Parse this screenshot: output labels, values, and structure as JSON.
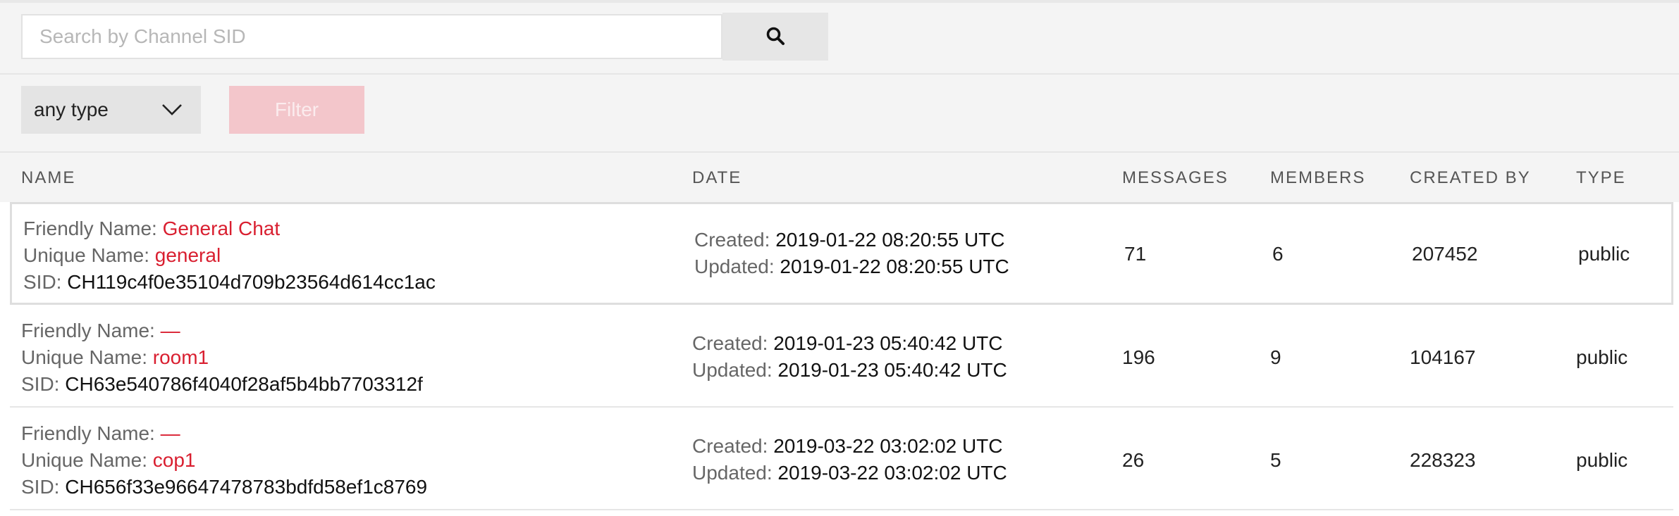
{
  "search": {
    "placeholder": "Search by Channel SID"
  },
  "filter": {
    "type_selected": "any type",
    "button_label": "Filter"
  },
  "columns": {
    "name": "NAME",
    "date": "DATE",
    "messages": "MESSAGES",
    "members": "MEMBERS",
    "created_by": "CREATED BY",
    "type": "TYPE"
  },
  "labels": {
    "friendly": "Friendly Name:",
    "unique": "Unique Name:",
    "sid": "SID:",
    "created": "Created:",
    "updated": "Updated:"
  },
  "rows": [
    {
      "friendly_name": "General Chat",
      "unique_name": "general",
      "sid": "CH119c4f0e35104d709b23564d614cc1ac",
      "created": "2019-01-22 08:20:55 UTC",
      "updated": "2019-01-22 08:20:55 UTC",
      "messages": "71",
      "members": "6",
      "created_by": "207452",
      "type": "public"
    },
    {
      "friendly_name": "—",
      "unique_name": "room1",
      "sid": "CH63e540786f4040f28af5b4bb7703312f",
      "created": "2019-01-23 05:40:42 UTC",
      "updated": "2019-01-23 05:40:42 UTC",
      "messages": "196",
      "members": "9",
      "created_by": "104167",
      "type": "public"
    },
    {
      "friendly_name": "—",
      "unique_name": "cop1",
      "sid": "CH656f33e96647478783bdfd58ef1c8769",
      "created": "2019-03-22 03:02:02 UTC",
      "updated": "2019-03-22 03:02:02 UTC",
      "messages": "26",
      "members": "5",
      "created_by": "228323",
      "type": "public"
    }
  ],
  "colors": {
    "accent_red": "#d91f30",
    "filter_disabled_bg": "#f3c6cb"
  },
  "icons": {
    "search": "search-icon",
    "dropdown": "chevron-down-icon"
  }
}
